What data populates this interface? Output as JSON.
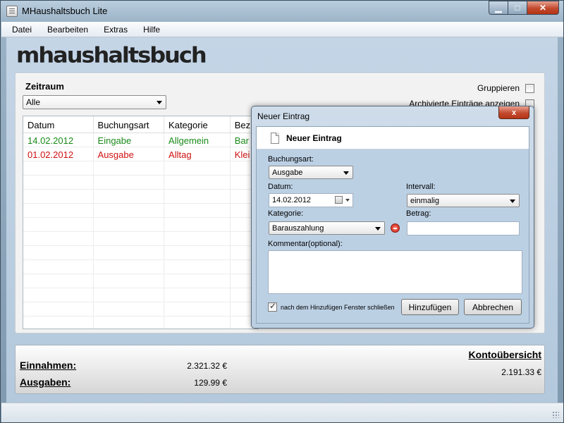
{
  "window": {
    "title": "MHaushaltsbuch Lite"
  },
  "menu": {
    "items": [
      "Datei",
      "Bearbeiten",
      "Extras",
      "Hilfe"
    ]
  },
  "logo": "mhaushaltsbuch",
  "zeitraum": {
    "label": "Zeitraum",
    "selected": "Alle"
  },
  "options": {
    "gruppieren": "Gruppieren",
    "archivierte": "Archivierte Einträge anzeigen"
  },
  "table": {
    "columns": [
      "Datum",
      "Buchungsart",
      "Kategorie",
      "Bez"
    ],
    "rows": [
      {
        "datum": "14.02.2012",
        "buchungsart": "Eingabe",
        "kategorie": "Allgemein",
        "bez": "Bar"
      },
      {
        "datum": "01.02.2012",
        "buchungsart": "Ausgabe",
        "kategorie": "Alltag",
        "bez": "Klei"
      }
    ]
  },
  "summary": {
    "einnahmen_label": "Einnahmen:",
    "einnahmen_value": "2.321.32 €",
    "ausgaben_label": "Ausgaben:",
    "ausgaben_value": "129.99 €",
    "konto_title": "Kontoübersicht",
    "konto_value": "2.191.33 €"
  },
  "dialog": {
    "title": "Neuer Eintrag",
    "close": "x",
    "header": "Neuer Eintrag",
    "buchungsart_label": "Buchungsart:",
    "buchungsart_value": "Ausgabe",
    "datum_label": "Datum:",
    "datum_value": "14.02.2012",
    "intervall_label": "Intervall:",
    "intervall_value": "einmalig",
    "kategorie_label": "Kategorie:",
    "kategorie_value": "Barauszahlung",
    "betrag_label": "Betrag:",
    "betrag_value": "",
    "kommentar_label": "Kommentar(optional):",
    "kommentar_value": "",
    "close_after_label": "nach dem Hinzufügen Fenster schließen",
    "close_after_checked": true,
    "add_button": "Hinzufügen",
    "cancel_button": "Abbrechen"
  },
  "colors": {
    "income": "#1a8a1a",
    "expense": "#d01010"
  }
}
